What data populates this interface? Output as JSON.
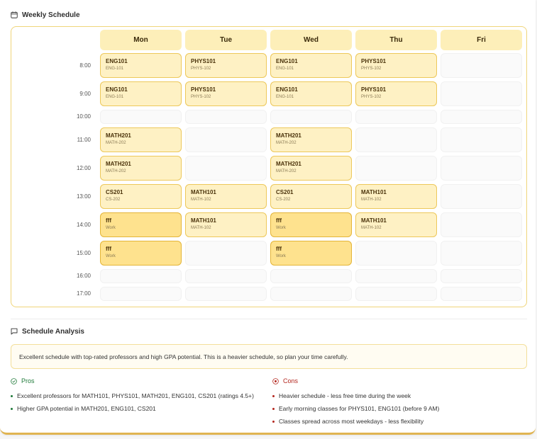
{
  "schedule": {
    "title": "Weekly Schedule",
    "days": [
      "Mon",
      "Tue",
      "Wed",
      "Thu",
      "Fri"
    ],
    "times": [
      "8:00",
      "9:00",
      "10:00",
      "11:00",
      "12:00",
      "13:00",
      "14:00",
      "15:00",
      "16:00",
      "17:00"
    ],
    "blocks": [
      {
        "day": "Mon",
        "time": "8:00",
        "code": "ENG101",
        "sub": "ENG-101",
        "kind": "course"
      },
      {
        "day": "Tue",
        "time": "8:00",
        "code": "PHYS101",
        "sub": "PHYS-102",
        "kind": "course"
      },
      {
        "day": "Wed",
        "time": "8:00",
        "code": "ENG101",
        "sub": "ENG-101",
        "kind": "course"
      },
      {
        "day": "Thu",
        "time": "8:00",
        "code": "PHYS101",
        "sub": "PHYS-102",
        "kind": "course"
      },
      {
        "day": "Mon",
        "time": "9:00",
        "code": "ENG101",
        "sub": "ENG-101",
        "kind": "course"
      },
      {
        "day": "Tue",
        "time": "9:00",
        "code": "PHYS101",
        "sub": "PHYS-102",
        "kind": "course"
      },
      {
        "day": "Wed",
        "time": "9:00",
        "code": "ENG101",
        "sub": "ENG-101",
        "kind": "course"
      },
      {
        "day": "Thu",
        "time": "9:00",
        "code": "PHYS101",
        "sub": "PHYS-102",
        "kind": "course"
      },
      {
        "day": "Mon",
        "time": "11:00",
        "code": "MATH201",
        "sub": "MATH-202",
        "kind": "course"
      },
      {
        "day": "Wed",
        "time": "11:00",
        "code": "MATH201",
        "sub": "MATH-202",
        "kind": "course"
      },
      {
        "day": "Mon",
        "time": "12:00",
        "code": "MATH201",
        "sub": "MATH-202",
        "kind": "course"
      },
      {
        "day": "Wed",
        "time": "12:00",
        "code": "MATH201",
        "sub": "MATH-202",
        "kind": "course"
      },
      {
        "day": "Mon",
        "time": "13:00",
        "code": "CS201",
        "sub": "CS-202",
        "kind": "course"
      },
      {
        "day": "Tue",
        "time": "13:00",
        "code": "MATH101",
        "sub": "MATH-102",
        "kind": "course"
      },
      {
        "day": "Wed",
        "time": "13:00",
        "code": "CS201",
        "sub": "CS-202",
        "kind": "course"
      },
      {
        "day": "Thu",
        "time": "13:00",
        "code": "MATH101",
        "sub": "MATH-102",
        "kind": "course"
      },
      {
        "day": "Mon",
        "time": "14:00",
        "code": "fff",
        "sub": "Work",
        "kind": "work"
      },
      {
        "day": "Tue",
        "time": "14:00",
        "code": "MATH101",
        "sub": "MATH-102",
        "kind": "course"
      },
      {
        "day": "Wed",
        "time": "14:00",
        "code": "fff",
        "sub": "Work",
        "kind": "work"
      },
      {
        "day": "Thu",
        "time": "14:00",
        "code": "MATH101",
        "sub": "MATH-102",
        "kind": "course"
      },
      {
        "day": "Mon",
        "time": "15:00",
        "code": "fff",
        "sub": "Work",
        "kind": "work"
      },
      {
        "day": "Wed",
        "time": "15:00",
        "code": "fff",
        "sub": "Work",
        "kind": "work"
      }
    ]
  },
  "analysis": {
    "title": "Schedule Analysis",
    "summary": "Excellent schedule with top-rated professors and high GPA potential. This is a heavier schedule, so plan your time carefully.",
    "pros_title": "Pros",
    "cons_title": "Cons",
    "pros": [
      "Excellent professors for MATH101, PHYS101, MATH201, ENG101, CS201 (ratings 4.5+)",
      "Higher GPA potential in MATH201, ENG101, CS201"
    ],
    "cons": [
      "Heavier schedule - less free time during the week",
      "Early morning classes for PHYS101, ENG101 (before 9 AM)",
      "Classes spread across most weekdays - less flexibility"
    ]
  },
  "colors": {
    "accent": "#e0b451",
    "course_fill": "#fef1c4",
    "work_fill": "#fee28e",
    "pros": "#1f7a3a",
    "cons": "#b3261e"
  }
}
